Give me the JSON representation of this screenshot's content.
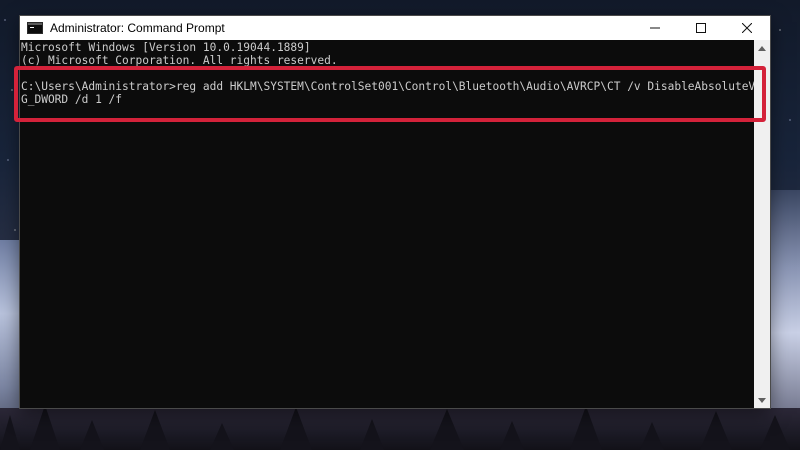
{
  "window": {
    "title": "Administrator: Command Prompt"
  },
  "console": {
    "lines": [
      "Microsoft Windows [Version 10.0.19044.1889]",
      "(c) Microsoft Corporation. All rights reserved.",
      "",
      "C:\\Users\\Administrator>reg add HKLM\\SYSTEM\\ControlSet001\\Control\\Bluetooth\\Audio\\AVRCP\\CT /v DisableAbsoluteVolume /t RE",
      "G_DWORD /d 1 /f"
    ]
  },
  "icons": {
    "app": "command-prompt-icon",
    "minimize": "minimize-icon",
    "maximize": "maximize-icon",
    "close": "close-icon"
  },
  "colors": {
    "console_bg": "#0c0c0c",
    "console_text": "#cccccc",
    "titlebar_bg": "#ffffff",
    "highlight": "#d4223a"
  }
}
